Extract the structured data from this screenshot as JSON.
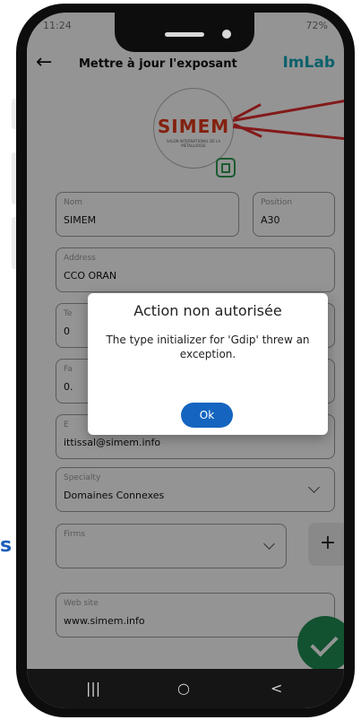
{
  "status_bar": {
    "time": "11:24",
    "battery": "72%"
  },
  "app_bar": {
    "title": "Mettre à jour l'exposant",
    "brand": "ImLab"
  },
  "logo": {
    "text": "SIMEM",
    "subtitle": "SALON INTERNATIONAL DE LA MÉTALLURGIE"
  },
  "form": {
    "name": {
      "label": "Nom",
      "value": "SIMEM"
    },
    "position": {
      "label": "Position",
      "value": "A30"
    },
    "address": {
      "label": "Address",
      "value": "CCO ORAN"
    },
    "phone": {
      "label": "Te",
      "value": "0"
    },
    "fax": {
      "label": "Fa",
      "value": "0."
    },
    "email": {
      "label": "E",
      "value": "ittissal@simem.info"
    },
    "specialty": {
      "label": "Specialty",
      "value": "Domaines Connexes"
    },
    "firms": {
      "label": "Firms",
      "value": ""
    },
    "website": {
      "label": "Web site",
      "value": "www.simem.info"
    }
  },
  "dialog": {
    "title": "Action non autorisée",
    "message": "The type initializer for 'Gdip' threw an exception.",
    "ok_label": "Ok"
  },
  "navbar": {
    "recent": "|||",
    "home": "○",
    "back": "<"
  },
  "outside_text": "s",
  "colors": {
    "accent": "#1565c0",
    "fab": "#1f8e55",
    "annotation": "#e22d2d",
    "brand": "#16a7b8"
  }
}
